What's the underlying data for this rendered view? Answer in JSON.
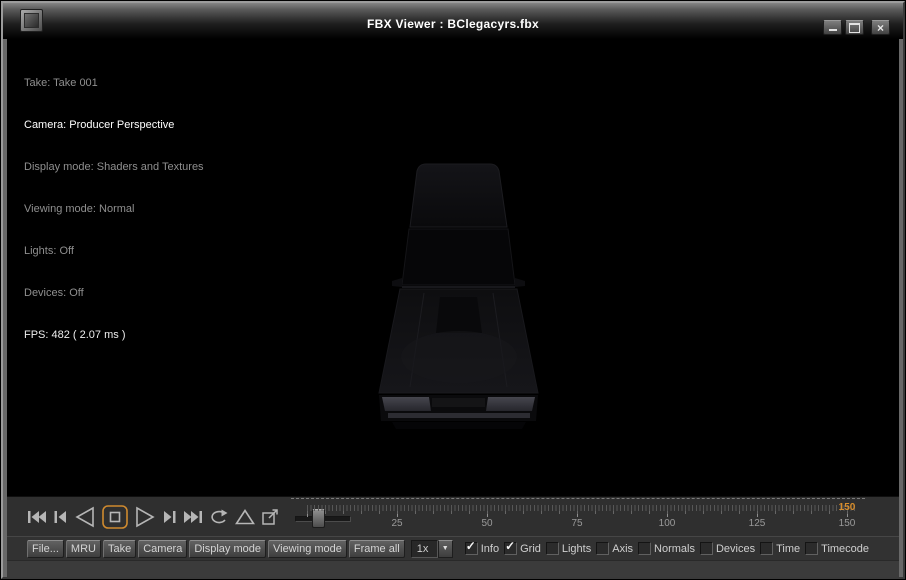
{
  "window": {
    "title": "FBX Viewer : BClegacyrs.fbx",
    "controls": {
      "minimize": "minimize",
      "maximize": "maximize",
      "close": "close"
    }
  },
  "hud": {
    "lines": [
      "Take: Take 001",
      "Camera: Producer Perspective",
      "Display mode: Shaders and Textures",
      "Viewing mode: Normal",
      "Lights: Off",
      "Devices: Off",
      "FPS: 482 ( 2.07 ms )"
    ]
  },
  "transport": {
    "buttons": [
      "jump-to-start",
      "step-back",
      "play-backward",
      "stop",
      "play-forward",
      "step-forward",
      "jump-to-end",
      "loop",
      "up-triangle",
      "snapshot"
    ],
    "active_button": "stop",
    "active_outline_color": "#cf8a2f"
  },
  "timeline": {
    "tick_labels": [
      "25",
      "50",
      "75",
      "100",
      "125",
      "150"
    ],
    "current_frame": "150",
    "current_frame_color": "#d78d2c"
  },
  "toolbar": {
    "buttons": [
      "File...",
      "MRU",
      "Take",
      "Camera",
      "Display mode",
      "Viewing mode",
      "Frame all"
    ],
    "speed": "1x",
    "checkboxes": [
      {
        "label": "Info",
        "checked": true
      },
      {
        "label": "Grid",
        "checked": true
      },
      {
        "label": "Lights",
        "checked": false
      },
      {
        "label": "Axis",
        "checked": false
      },
      {
        "label": "Normals",
        "checked": false
      },
      {
        "label": "Devices",
        "checked": false
      },
      {
        "label": "Time",
        "checked": false
      },
      {
        "label": "Timecode",
        "checked": false
      }
    ]
  }
}
